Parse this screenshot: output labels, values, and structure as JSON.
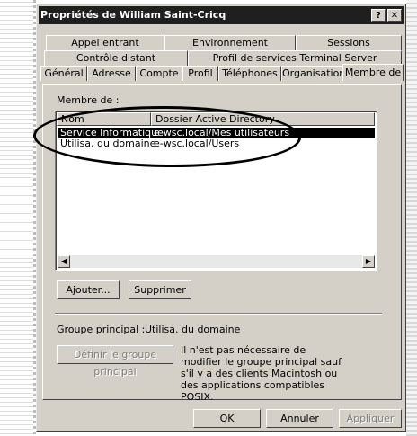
{
  "window": {
    "title": "Propriétés de William Saint-Cricq",
    "help_btn": "?",
    "close_btn": "✕"
  },
  "tabs": {
    "row1": [
      "Appel entrant",
      "Environnement",
      "Sessions"
    ],
    "row2": [
      "Contrôle distant",
      "Profil de services Terminal Server"
    ],
    "row3": [
      "Général",
      "Adresse",
      "Compte",
      "Profil",
      "Téléphones",
      "Organisation",
      "Membre de"
    ],
    "active": "Membre de"
  },
  "members": {
    "section_label": "Membre de :",
    "columns": [
      "Nom",
      "Dossier Active Directory"
    ],
    "rows": [
      {
        "name": "Service Informatique",
        "folder": "e-wsc.local/Mes utilisateurs",
        "selected": true
      },
      {
        "name": "Utilisa. du domaine",
        "folder": "e-wsc.local/Users",
        "selected": false
      }
    ]
  },
  "buttons": {
    "add": "Ajouter...",
    "remove": "Supprimer",
    "set_primary": "Définir le groupe principal",
    "ok": "OK",
    "cancel": "Annuler",
    "apply": "Appliquer"
  },
  "primary_group": {
    "label": "Groupe principal :",
    "value": "Utilisa. du domaine",
    "note": "Il n'est pas nécessaire de modifier le groupe principal sauf s'il y a des clients Macintosh ou des applications compatibles POSIX."
  },
  "icons": {
    "scroll_left": "◀",
    "scroll_right": "▶"
  }
}
